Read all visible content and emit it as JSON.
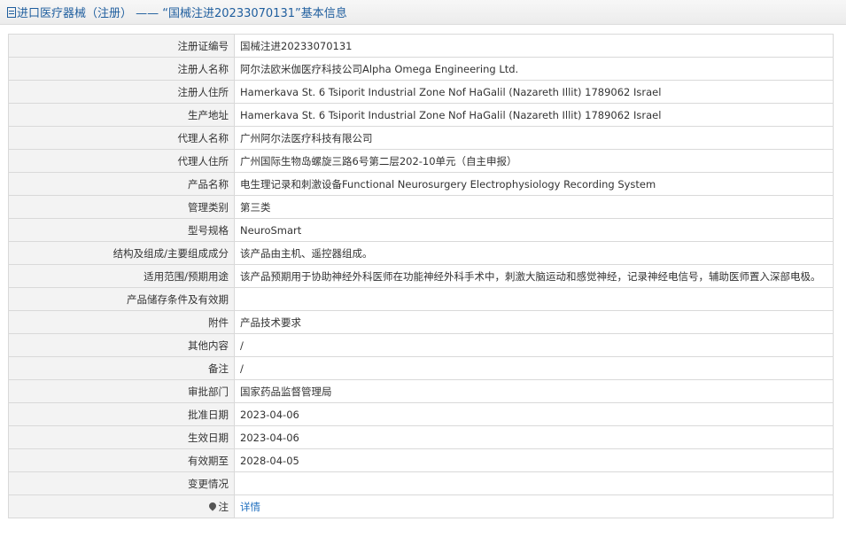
{
  "header": {
    "prefix": "进口医疗器械（注册） —— “国械注进20233070131”基本信息"
  },
  "icons": {
    "title": "document-icon",
    "note": "pin-icon"
  },
  "colors": {
    "title_text": "#1f5e9e",
    "label_bg": "#f3f3f3",
    "border": "#d9d9d9",
    "link": "#1f6fbf"
  },
  "rows": [
    {
      "label": "注册证编号",
      "value": "国械注进20233070131"
    },
    {
      "label": "注册人名称",
      "value": "阿尔法欧米伽医疗科技公司Alpha Omega Engineering Ltd."
    },
    {
      "label": "注册人住所",
      "value": "Hamerkava St. 6 Tsiporit Industrial Zone Nof HaGalil (Nazareth Illit) 1789062 Israel"
    },
    {
      "label": "生产地址",
      "value": "Hamerkava St. 6 Tsiporit Industrial Zone Nof HaGalil (Nazareth Illit) 1789062 Israel"
    },
    {
      "label": "代理人名称",
      "value": "广州阿尔法医疗科技有限公司"
    },
    {
      "label": "代理人住所",
      "value": "广州国际生物岛螺旋三路6号第二层202-10单元（自主申报）"
    },
    {
      "label": "产品名称",
      "value": "电生理记录和刺激设备Functional Neurosurgery Electrophysiology Recording System"
    },
    {
      "label": "管理类别",
      "value": "第三类"
    },
    {
      "label": "型号规格",
      "value": "NeuroSmart"
    },
    {
      "label": "结构及组成/主要组成成分",
      "value": "该产品由主机、遥控器组成。"
    },
    {
      "label": "适用范围/预期用途",
      "value": "该产品预期用于协助神经外科医师在功能神经外科手术中，刺激大脑运动和感觉神经，记录神经电信号，辅助医师置入深部电极。"
    },
    {
      "label": "产品储存条件及有效期",
      "value": ""
    },
    {
      "label": "附件",
      "value": "产品技术要求"
    },
    {
      "label": "其他内容",
      "value": "/"
    },
    {
      "label": "备注",
      "value": "/"
    },
    {
      "label": "审批部门",
      "value": "国家药品监督管理局"
    },
    {
      "label": "批准日期",
      "value": "2023-04-06"
    },
    {
      "label": "生效日期",
      "value": "2023-04-06"
    },
    {
      "label": "有效期至",
      "value": "2028-04-05"
    },
    {
      "label": "变更情况",
      "value": ""
    }
  ],
  "note_row": {
    "label": "注",
    "link_text": "详情"
  }
}
